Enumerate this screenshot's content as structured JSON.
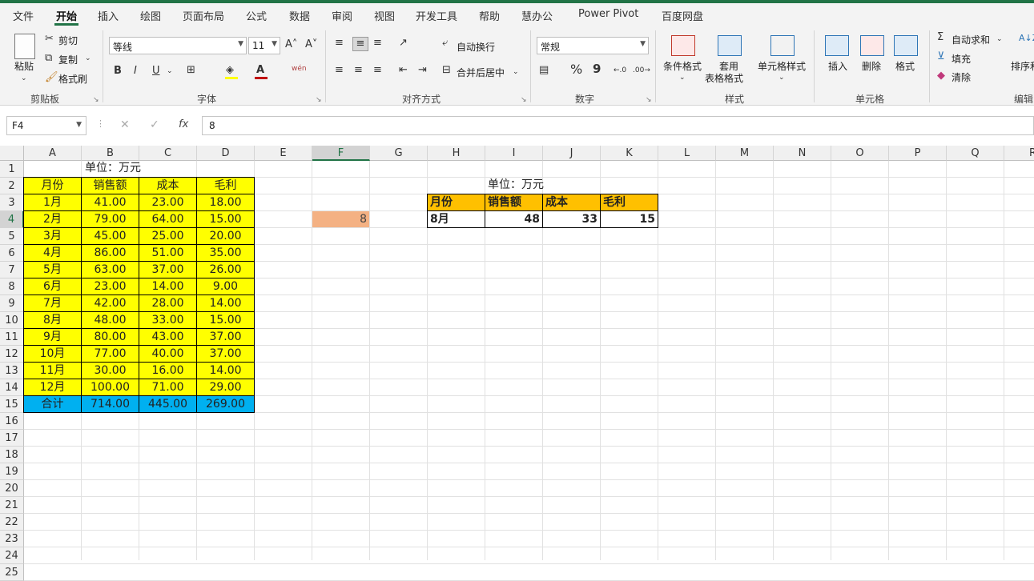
{
  "menu": [
    "文件",
    "开始",
    "插入",
    "绘图",
    "页面布局",
    "公式",
    "数据",
    "审阅",
    "视图",
    "开发工具",
    "帮助",
    "慧办公",
    "Power Pivot",
    "百度网盘"
  ],
  "ribbon": {
    "clipboard": {
      "paste": "粘贴",
      "cut": "剪切",
      "copy": "复制",
      "format_painter": "格式刷",
      "label": "剪贴板"
    },
    "font": {
      "font_name": "等线",
      "font_size": "11",
      "bold": "B",
      "italic": "I",
      "underline": "U",
      "label": "字体"
    },
    "align": {
      "wrap": "自动换行",
      "merge": "合并后居中",
      "label": "对齐方式"
    },
    "number": {
      "format": "常规",
      "percent": "%",
      "comma": "9",
      "label": "数字"
    },
    "styles": {
      "cond": "条件格式",
      "table_fmt_1": "套用",
      "table_fmt_2": "表格格式",
      "cell_style": "单元格样式",
      "label": "样式"
    },
    "cells": {
      "insert": "插入",
      "delete": "删除",
      "format": "格式",
      "label": "单元格"
    },
    "edit": {
      "autosum": "自动求和",
      "fill": "填充",
      "clear": "清除",
      "sort": "排序和",
      "label": "编辑"
    }
  },
  "formula_bar": {
    "name_box": "F4",
    "fx": "fx",
    "formula": "8"
  },
  "columns": [
    "A",
    "B",
    "C",
    "D",
    "E",
    "F",
    "G",
    "H",
    "I",
    "J",
    "K",
    "L",
    "M",
    "N",
    "O",
    "P",
    "Q",
    "R"
  ],
  "rows": [
    "1",
    "2",
    "3",
    "4",
    "5",
    "6",
    "7",
    "8",
    "9",
    "10",
    "11",
    "12",
    "13",
    "14",
    "15",
    "16",
    "17",
    "18",
    "19",
    "20",
    "21",
    "22",
    "23",
    "24",
    "25"
  ],
  "sheet": {
    "unit_left": "单位：万元",
    "headers": [
      "月份",
      "销售额",
      "成本",
      "毛利"
    ],
    "data": [
      [
        "1月",
        "41.00",
        "23.00",
        "18.00"
      ],
      [
        "2月",
        "79.00",
        "64.00",
        "15.00"
      ],
      [
        "3月",
        "45.00",
        "25.00",
        "20.00"
      ],
      [
        "4月",
        "86.00",
        "51.00",
        "35.00"
      ],
      [
        "5月",
        "63.00",
        "37.00",
        "26.00"
      ],
      [
        "6月",
        "23.00",
        "14.00",
        "9.00"
      ],
      [
        "7月",
        "42.00",
        "28.00",
        "14.00"
      ],
      [
        "8月",
        "48.00",
        "33.00",
        "15.00"
      ],
      [
        "9月",
        "80.00",
        "43.00",
        "37.00"
      ],
      [
        "10月",
        "77.00",
        "40.00",
        "37.00"
      ],
      [
        "11月",
        "30.00",
        "16.00",
        "14.00"
      ],
      [
        "12月",
        "100.00",
        "71.00",
        "29.00"
      ]
    ],
    "total": [
      "合计",
      "714.00",
      "445.00",
      "269.00"
    ],
    "f4_value": "8",
    "unit_right": "单位：万元",
    "lookup_headers": [
      "月份",
      "销售额",
      "成本",
      "毛利"
    ],
    "lookup_row": [
      "8月",
      "48",
      "33",
      "15"
    ]
  },
  "colors": {
    "excel_green": "#217346",
    "yellow": "#ffff00",
    "blue": "#00b0f0",
    "orange": "#ffc000",
    "salmon": "#f4b183"
  }
}
